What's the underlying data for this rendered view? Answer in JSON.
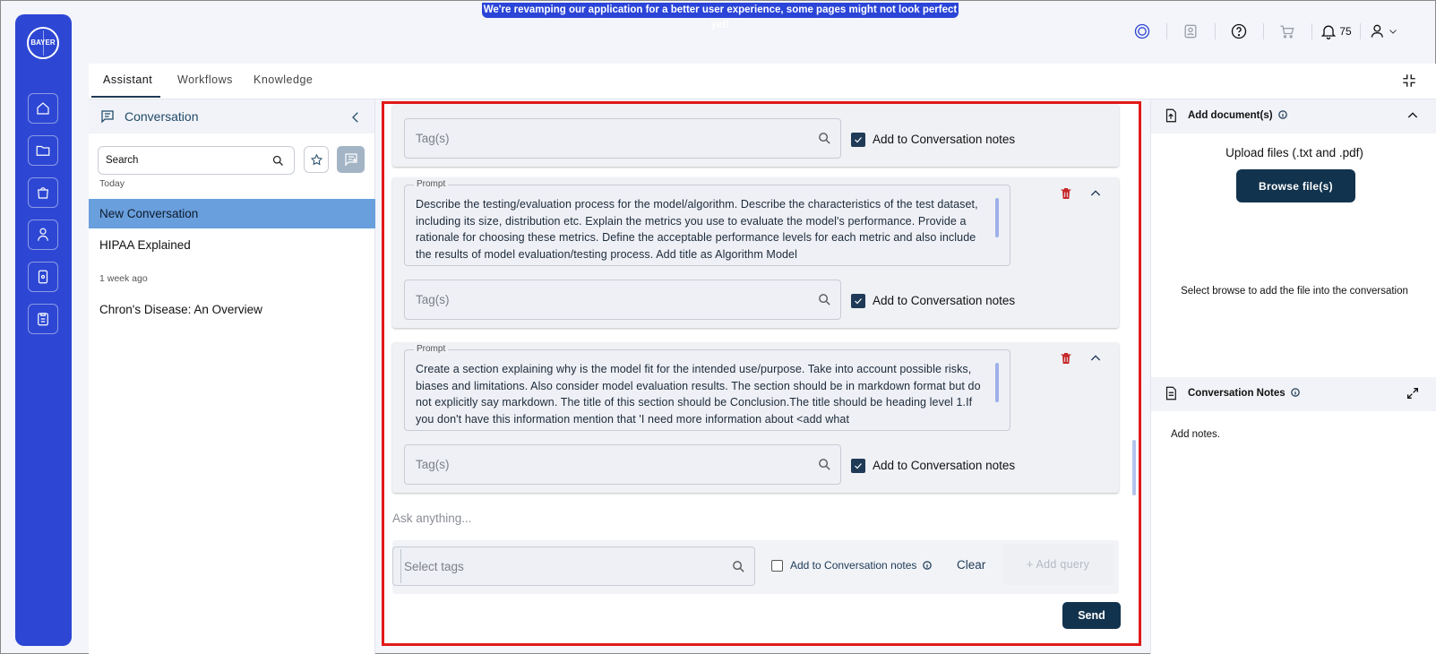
{
  "banner": "We're revamping our application for a better user experience, some pages might not look perfect yet!",
  "brand": {
    "logo_text": "BAYER"
  },
  "header": {
    "notification_count": "75"
  },
  "tabs": [
    {
      "label": "Assistant",
      "active": true
    },
    {
      "label": "Workflows",
      "active": false
    },
    {
      "label": "Knowledge",
      "active": false
    }
  ],
  "left_panel": {
    "title": "Conversation",
    "search_placeholder": "Search",
    "groups": [
      {
        "label": "Today",
        "items": [
          "New Conversation",
          "HIPAA Explained"
        ]
      },
      {
        "label": "1 week ago",
        "items": [
          "Chron's Disease: An Overview"
        ]
      }
    ]
  },
  "center": {
    "tag_placeholder": "Tag(s)",
    "add_to_notes_label": "Add to Conversation notes",
    "prompt_legend": "Prompt",
    "prompts": [
      "Describe the testing/evaluation process for the model/algorithm. Describe the characteristics of the test dataset, including its size, distribution etc. Explain the metrics you use to evaluate the model's performance. Provide a rationale for choosing these metrics. Define the acceptable performance levels for each metric and also include the results of model evaluation/testing process. Add title as Algorithm Model",
      "Create a section explaining why is the model fit for the intended use/purpose. Take into account possible risks, biases and limitations. Also consider model evaluation results. The section should be in markdown format but do not explicitly say markdown. The title of this section should be Conclusion.The title should be heading level 1.If you don't have this information mention that 'I need more information about <add what"
    ],
    "ask_placeholder": "Ask anything...",
    "select_tags_placeholder": "Select tags",
    "query_notes_label": "Add to Conversation notes",
    "clear_label": "Clear",
    "add_query_label": "+ Add query",
    "send_label": "Send"
  },
  "right_panel": {
    "add_docs_title": "Add document(s)",
    "upload_text": "Upload files (.txt and .pdf)",
    "browse_label": "Browse file(s)",
    "browse_hint": "Select browse to add the file into the conversation",
    "notes_title": "Conversation Notes",
    "notes_placeholder": "Add notes."
  },
  "colors": {
    "rail": "#2d47d4",
    "accent_dark": "#12334d",
    "active_item": "#6a9fdd",
    "focus_border": "#e21919",
    "delete": "#c62828"
  }
}
